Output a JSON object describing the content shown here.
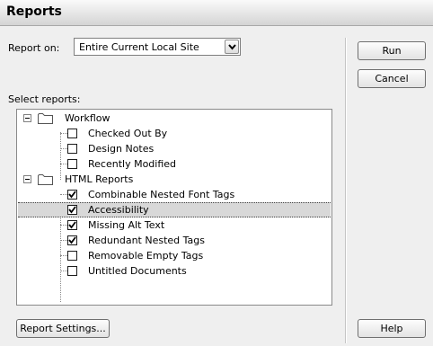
{
  "window": {
    "title": "Reports"
  },
  "report_on": {
    "label": "Report on:",
    "selected": "Entire Current Local Site"
  },
  "select_reports_label": "Select reports:",
  "tree": {
    "groups": [
      {
        "label": "Workflow",
        "expanded": true,
        "items": [
          {
            "label": "Checked Out By",
            "checked": false
          },
          {
            "label": "Design Notes",
            "checked": false
          },
          {
            "label": "Recently Modified",
            "checked": false
          }
        ]
      },
      {
        "label": "HTML Reports",
        "expanded": true,
        "items": [
          {
            "label": "Combinable Nested Font Tags",
            "checked": true
          },
          {
            "label": "Accessibility",
            "checked": true,
            "selected": true
          },
          {
            "label": "Missing Alt Text",
            "checked": true
          },
          {
            "label": "Redundant Nested Tags",
            "checked": true
          },
          {
            "label": "Removable Empty Tags",
            "checked": false
          },
          {
            "label": "Untitled Documents",
            "checked": false
          }
        ]
      }
    ]
  },
  "buttons": {
    "run": "Run",
    "cancel": "Cancel",
    "report_settings": "Report Settings...",
    "help": "Help"
  }
}
